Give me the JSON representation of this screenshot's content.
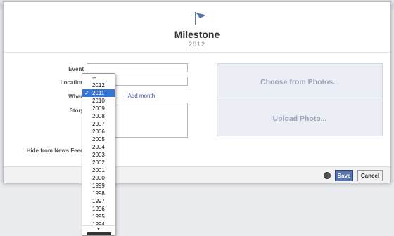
{
  "dialog": {
    "title": "Milestone",
    "year": "2012"
  },
  "form": {
    "event_label": "Event",
    "location_label": "Location",
    "when_label": "When",
    "story_label": "Story",
    "hide_label": "Hide from News Feed",
    "add_month": "+ Add month"
  },
  "photos": {
    "choose": "Choose from Photos...",
    "upload": "Upload Photo..."
  },
  "footer": {
    "save": "Save",
    "cancel": "Cancel"
  },
  "year_select": {
    "selected": "2011",
    "options": [
      "--",
      "2012",
      "2011",
      "2010",
      "2009",
      "2008",
      "2007",
      "2006",
      "2005",
      "2004",
      "2003",
      "2002",
      "2001",
      "2000",
      "1999",
      "1998",
      "1997",
      "1996",
      "1995",
      "1994"
    ]
  },
  "colors": {
    "accent": "#3b5998",
    "selection": "#3574d8"
  }
}
